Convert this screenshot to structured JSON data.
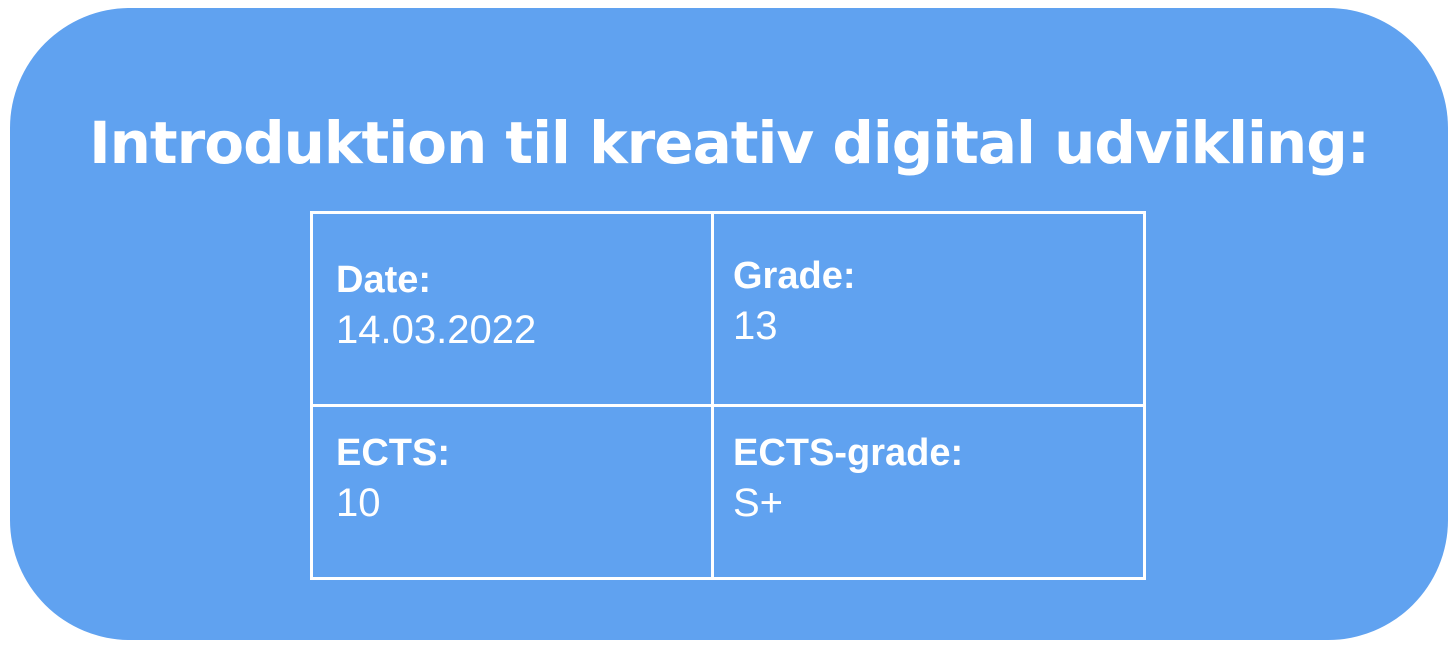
{
  "title": "Introduktion til kreativ digital udvikling:",
  "colors": {
    "card_background": "#60a2f0",
    "text": "#ffffff",
    "border": "#ffffff"
  },
  "grid": {
    "date": {
      "label": "Date:",
      "value": "14.03.2022"
    },
    "grade": {
      "label": "Grade:",
      "value": "13"
    },
    "ects": {
      "label": "ECTS:",
      "value": "10"
    },
    "ects_grade": {
      "label": "ECTS-grade:",
      "value": "S+"
    }
  }
}
